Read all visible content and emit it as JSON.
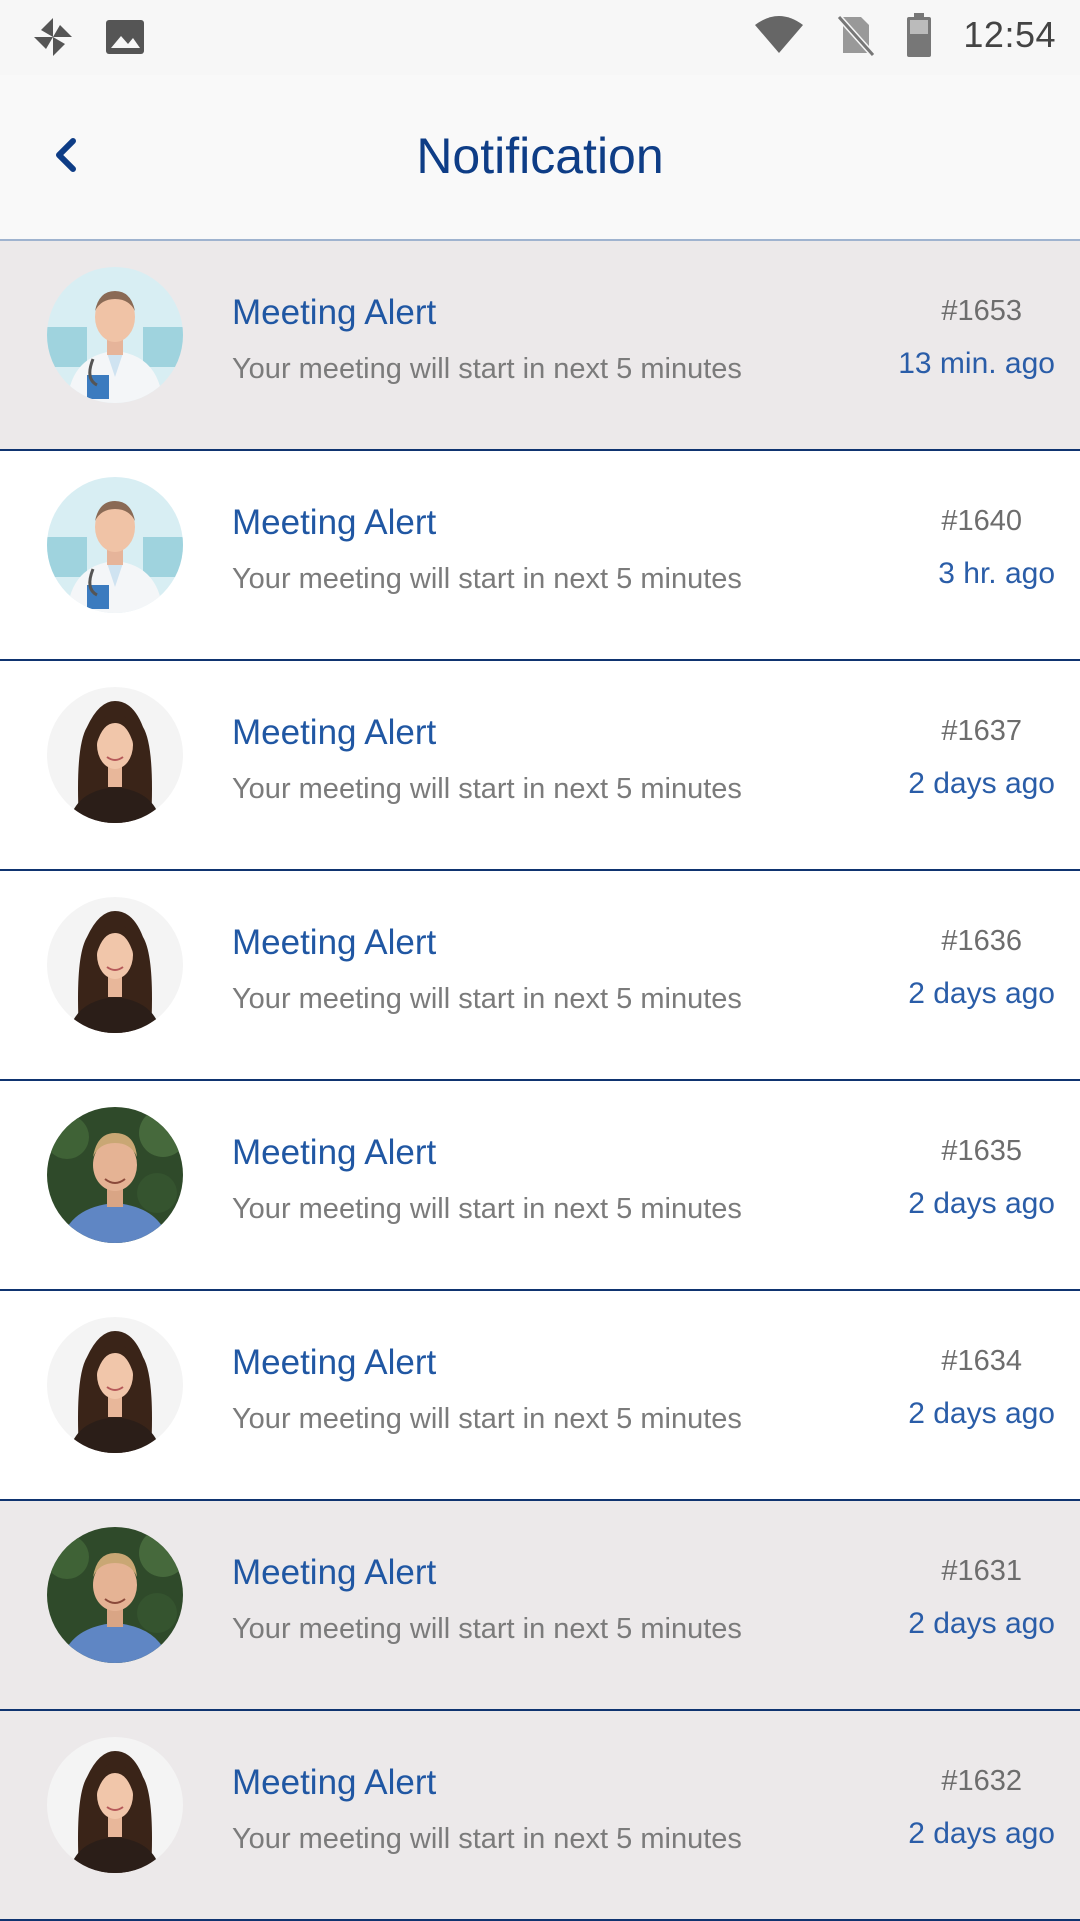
{
  "status_bar": {
    "time": "12:54",
    "icons": [
      "pinwheel-icon",
      "gallery-icon",
      "wifi-icon",
      "no-sim-icon",
      "battery-icon"
    ]
  },
  "header": {
    "title": "Notification",
    "back_icon": "chevron-left-icon"
  },
  "colors": {
    "accent": "#0e3d86",
    "title_blue": "#2057a3",
    "highlight_row": "#ece9ea",
    "divider": "#0f3470"
  },
  "notifications": [
    {
      "title": "Meeting Alert",
      "message": "Your meeting will start in next 5 minutes",
      "id": "#1653",
      "time": "13 min. ago",
      "avatar": "doctor-avatar",
      "highlighted": true
    },
    {
      "title": "Meeting Alert",
      "message": "Your meeting will start in next 5 minutes",
      "id": "#1640",
      "time": "3 hr. ago",
      "avatar": "doctor-avatar",
      "highlighted": false
    },
    {
      "title": "Meeting Alert",
      "message": "Your meeting will start in next 5 minutes",
      "id": "#1637",
      "time": "2 days ago",
      "avatar": "woman-avatar",
      "highlighted": false
    },
    {
      "title": "Meeting Alert",
      "message": "Your meeting will start in next 5 minutes",
      "id": "#1636",
      "time": "2 days ago",
      "avatar": "woman-avatar",
      "highlighted": false
    },
    {
      "title": "Meeting Alert",
      "message": "Your meeting will start in next 5 minutes",
      "id": "#1635",
      "time": "2 days ago",
      "avatar": "man-avatar",
      "highlighted": false
    },
    {
      "title": "Meeting Alert",
      "message": "Your meeting will start in next 5 minutes",
      "id": "#1634",
      "time": "2 days ago",
      "avatar": "woman-avatar",
      "highlighted": false
    },
    {
      "title": "Meeting Alert",
      "message": "Your meeting will start in next 5 minutes",
      "id": "#1631",
      "time": "2 days ago",
      "avatar": "man-avatar",
      "highlighted": true
    },
    {
      "title": "Meeting Alert",
      "message": "Your meeting will start in next 5 minutes",
      "id": "#1632",
      "time": "2 days ago",
      "avatar": "woman-avatar",
      "highlighted": true
    }
  ]
}
